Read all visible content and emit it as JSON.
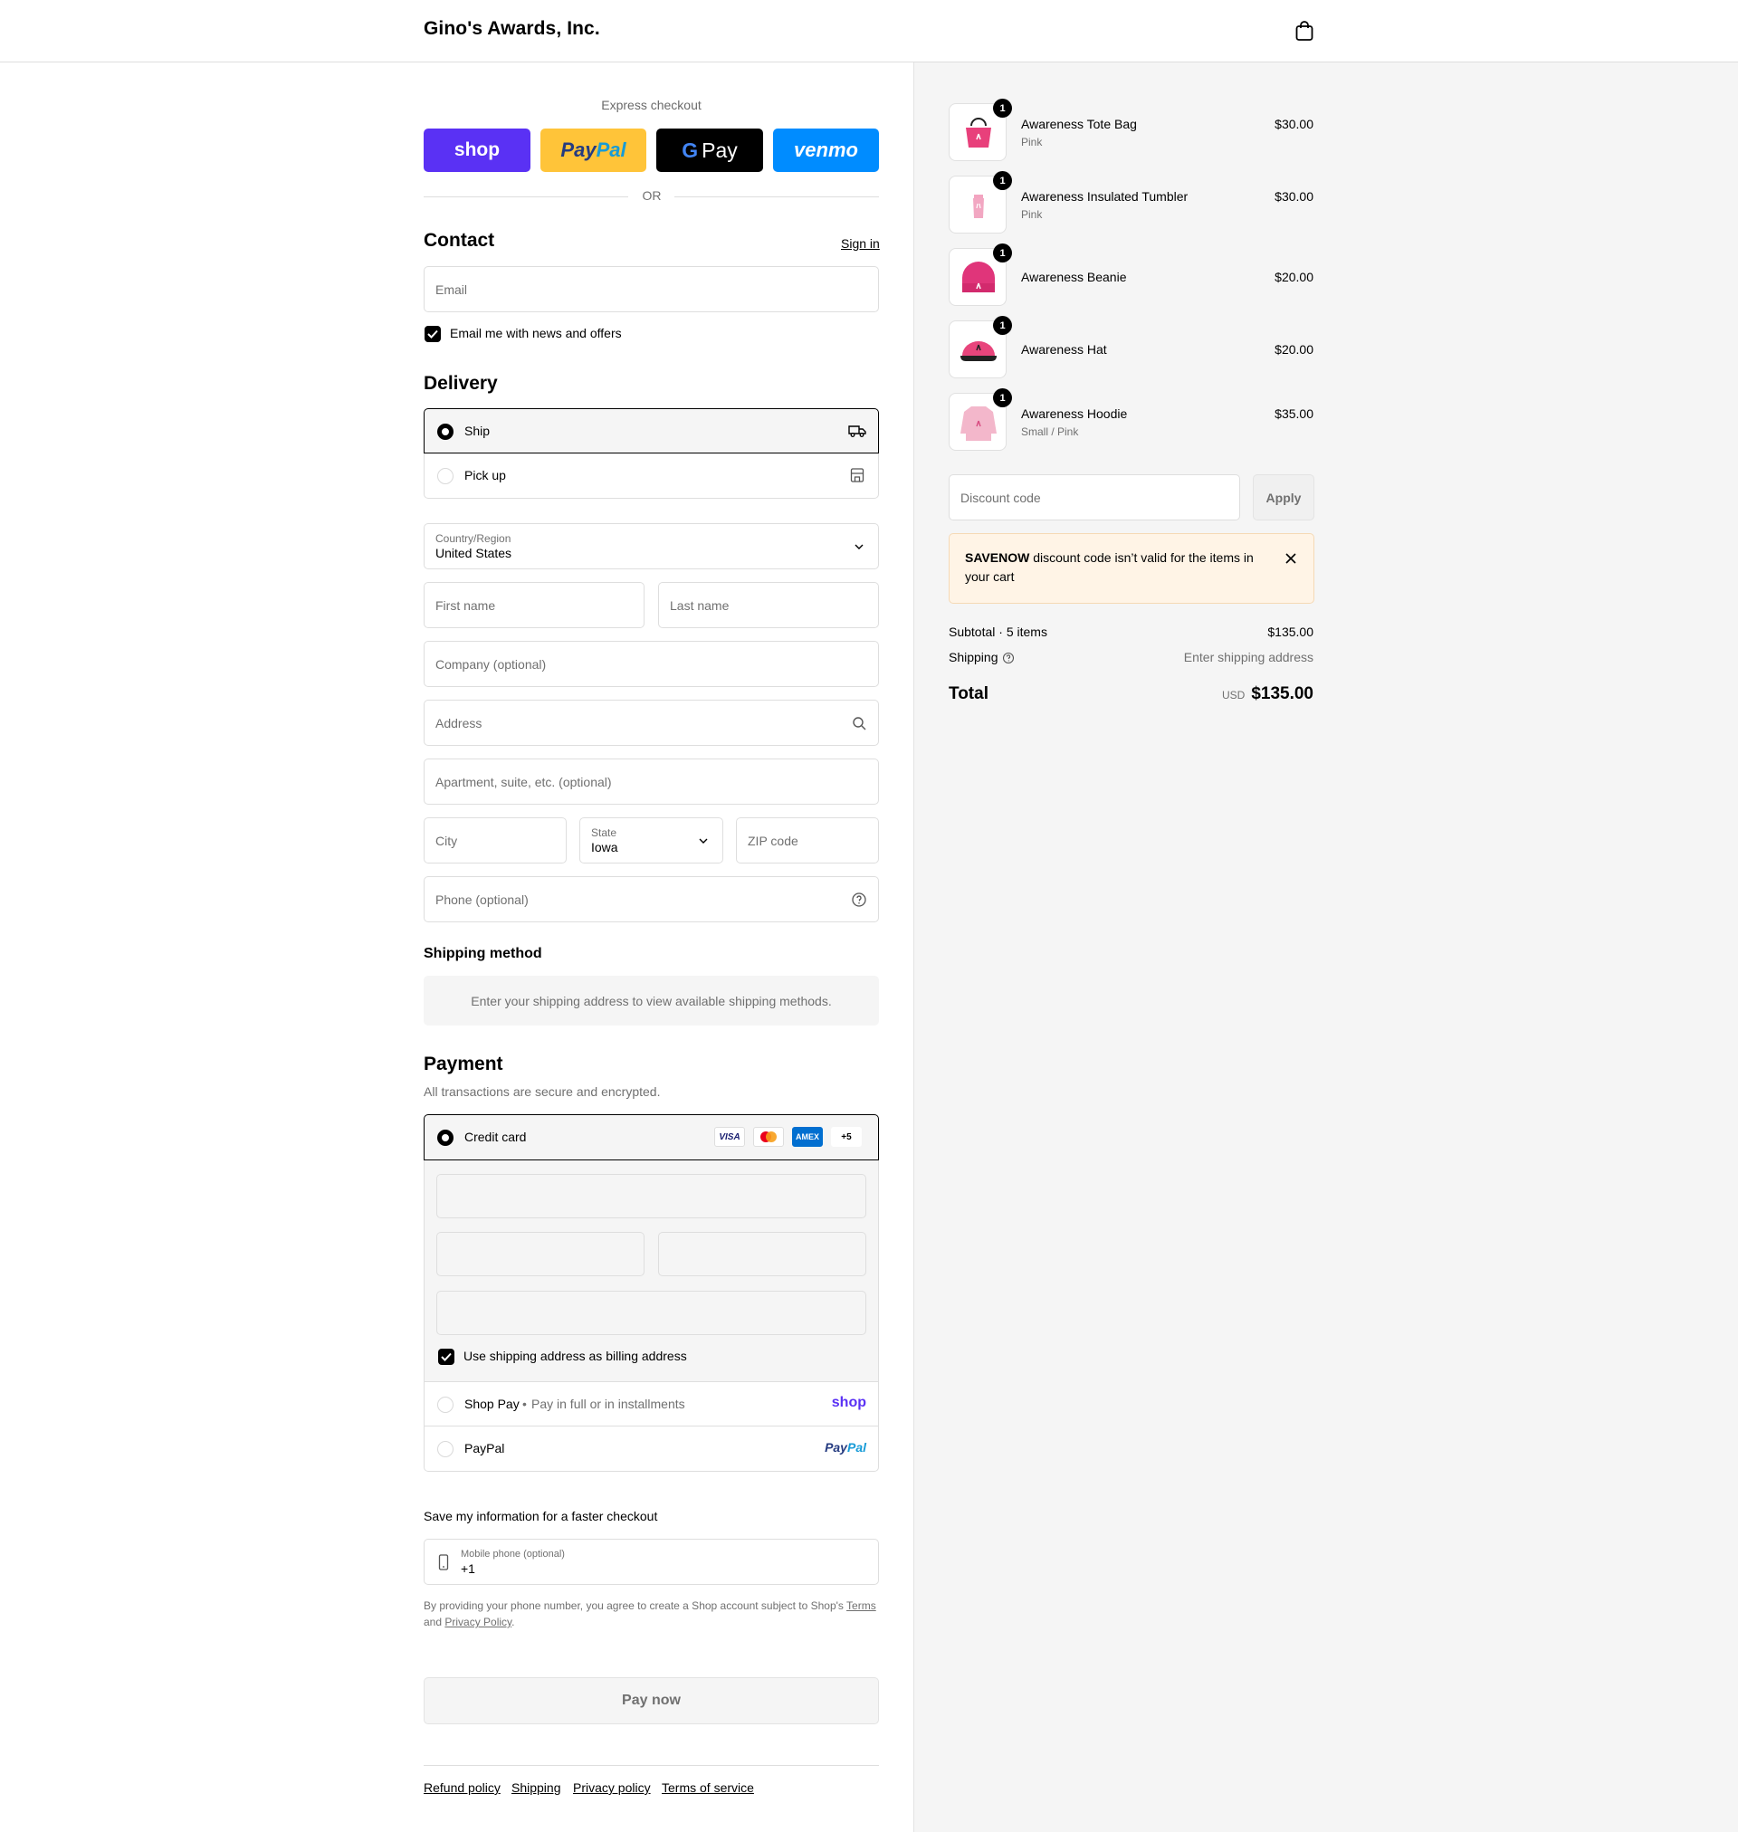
{
  "header": {
    "brand": "Gino's Awards, Inc.",
    "cart_icon": "shopping-bag-icon"
  },
  "express": {
    "title": "Express checkout",
    "buttons": {
      "shop": "shop",
      "paypal_a": "Pay",
      "paypal_b": "Pal",
      "gpay_g": "G",
      "gpay_pay": "Pay",
      "venmo": "venmo"
    },
    "or": "OR",
    "colors": {
      "shop": "#5a31f4",
      "paypal": "#ffc439",
      "gpay": "#000000",
      "venmo": "#008cff"
    }
  },
  "contact": {
    "title": "Contact",
    "sign_in": "Sign in",
    "email_placeholder": "Email",
    "news_label": "Email me with news and offers",
    "news_checked": true
  },
  "delivery": {
    "title": "Delivery",
    "options": [
      {
        "label": "Ship",
        "selected": true,
        "icon": "truck-icon"
      },
      {
        "label": "Pick up",
        "selected": false,
        "icon": "store-icon"
      }
    ],
    "country_label": "Country/Region",
    "country_value": "United States",
    "first_name": "First name",
    "last_name": "Last name",
    "company": "Company (optional)",
    "address": "Address",
    "apartment": "Apartment, suite, etc. (optional)",
    "city": "City",
    "state_label": "State",
    "state_value": "Iowa",
    "zip": "ZIP code",
    "phone": "Phone (optional)"
  },
  "shipping_method": {
    "title": "Shipping method",
    "info": "Enter your shipping address to view available shipping methods."
  },
  "payment": {
    "title": "Payment",
    "subtitle": "All transactions are secure and encrypted.",
    "credit_card": "Credit card",
    "brands": {
      "visa": "VISA",
      "amex": "AMEX",
      "more": "+5"
    },
    "billing_label": "Use shipping address as billing address",
    "billing_checked": true,
    "shop_pay": "Shop Pay",
    "shop_pay_sub": "Pay in full or in installments",
    "shop_pay_logo": "shop",
    "paypal": "PayPal",
    "paypal_logo_a": "Pay",
    "paypal_logo_b": "Pal"
  },
  "save_info": {
    "title": "Save my information for a faster checkout",
    "mobile_label": "Mobile phone (optional)",
    "mobile_value": "+1",
    "legal_prefix": "By providing your phone number, you agree to create a Shop account subject to Shop's",
    "terms": "Terms",
    "and": "and",
    "privacy": "Privacy Policy",
    "period": "."
  },
  "pay_now": "Pay now",
  "footer_links": [
    "Refund policy",
    "Shipping",
    "Privacy policy",
    "Terms of service"
  ],
  "order": {
    "items": [
      {
        "name": "Awareness Tote Bag",
        "variant": "Pink",
        "price": "$30.00",
        "qty": "1"
      },
      {
        "name": "Awareness Insulated Tumbler",
        "variant": "Pink",
        "price": "$30.00",
        "qty": "1"
      },
      {
        "name": "Awareness Beanie",
        "variant": "",
        "price": "$20.00",
        "qty": "1"
      },
      {
        "name": "Awareness Hat",
        "variant": "",
        "price": "$20.00",
        "qty": "1"
      },
      {
        "name": "Awareness Hoodie",
        "variant": "Small / Pink",
        "price": "$35.00",
        "qty": "1"
      }
    ],
    "discount_placeholder": "Discount code",
    "apply": "Apply",
    "alert_code": "SAVENOW",
    "alert_text": " discount code isn’t valid for the items in your cart",
    "subtotal_label": "Subtotal · 5 items",
    "subtotal_value": "$135.00",
    "shipping_label": "Shipping",
    "shipping_value": "Enter shipping address",
    "total_label": "Total",
    "currency": "USD",
    "total_value": "$135.00"
  }
}
